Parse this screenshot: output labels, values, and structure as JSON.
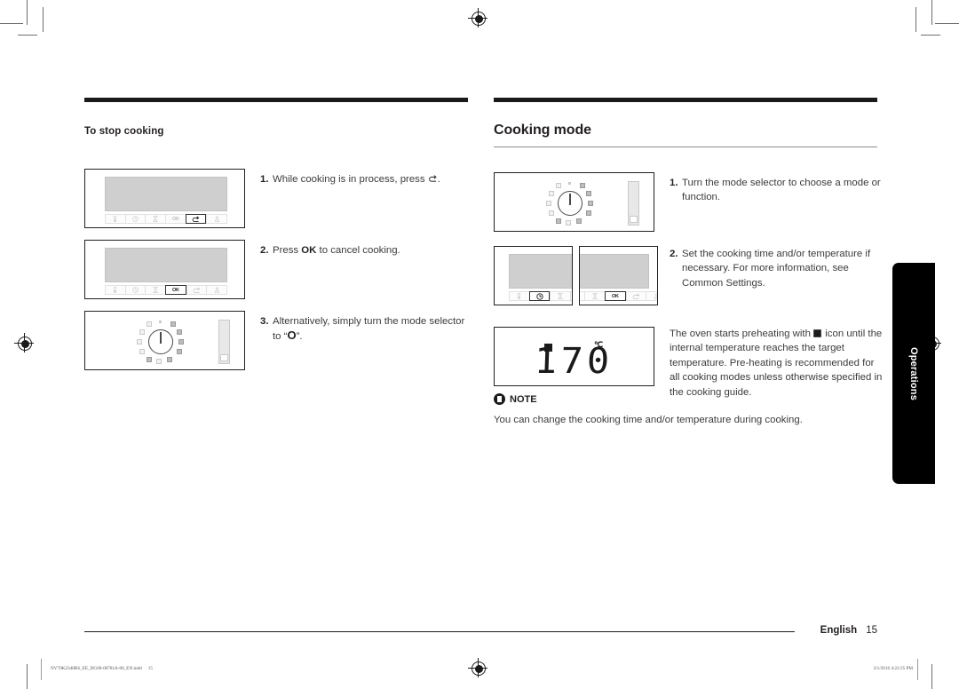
{
  "document": {
    "left_column": {
      "section_title": "To stop cooking",
      "steps": [
        {
          "num": "1.",
          "text": "While cooking is in process, press ",
          "icon": "back-arrow-icon",
          "after": "."
        },
        {
          "num": "2.",
          "text_before": "Press ",
          "bold": "OK",
          "text_after": " to cancel cooking."
        },
        {
          "num": "3.",
          "text_before": "Alternatively, simply turn the mode selector to “",
          "bold": "O",
          "text_after": "”."
        }
      ],
      "figures": [
        {
          "name": "control-panel-back-highlighted",
          "highlight": "back"
        },
        {
          "name": "control-panel-ok-highlighted",
          "highlight": "ok"
        },
        {
          "name": "mode-selector-dial-off"
        }
      ]
    },
    "right_column": {
      "section_title": "Cooking mode",
      "steps": [
        {
          "num": "1.",
          "lines": [
            "Turn the mode selector to choose a mode",
            "or function."
          ]
        },
        {
          "num": "2.",
          "lines": [
            "Set the cooking time and/or temperature",
            "if necessary.",
            "For more information, see Common",
            "Settings."
          ]
        }
      ],
      "paragraph": {
        "lines": [
          "The oven starts preheating with",
          "icon until the internal temperature reaches the",
          "target temperature.",
          "Pre-heating is recommended for all cooking",
          "modes unless otherwise specified in the",
          "cooking guide."
        ],
        "inline_icon": "preheat-icon"
      },
      "figures": [
        {
          "name": "mode-selector-dial-on"
        },
        {
          "name": "control-panel-clock-highlighted",
          "highlight": "clock"
        },
        {
          "name": "control-panel-ok-highlighted",
          "highlight": "ok"
        },
        {
          "name": "temperature-display"
        }
      ]
    },
    "display": {
      "value": "170",
      "unit": "℃",
      "icon": "preheat-icon"
    },
    "note": {
      "label": "NOTE",
      "text": "You can change the cooking time and/or temperature during cooking."
    },
    "side_tab": {
      "label": "Operations"
    },
    "footer": {
      "language": "English",
      "page_number": "15",
      "print_file": "NV70K2340RS_EE_DG68-00781A-00_EN.indd",
      "print_page": "15",
      "print_timestamp": "3/1/2016   4:22:25 PM"
    },
    "button_labels": {
      "ok": "OK",
      "oven_light": "oven-light-icon",
      "clock": "clock-icon",
      "timer": "timer-icon",
      "back": "back-arrow-icon",
      "child_lock": "child-lock-icon"
    },
    "colors": {
      "rule": "#1a1a1a",
      "body_text": "#3b3b3b",
      "heading": "#231f20",
      "lcd": "#cfcfcf",
      "tab_bg": "#000000"
    }
  }
}
